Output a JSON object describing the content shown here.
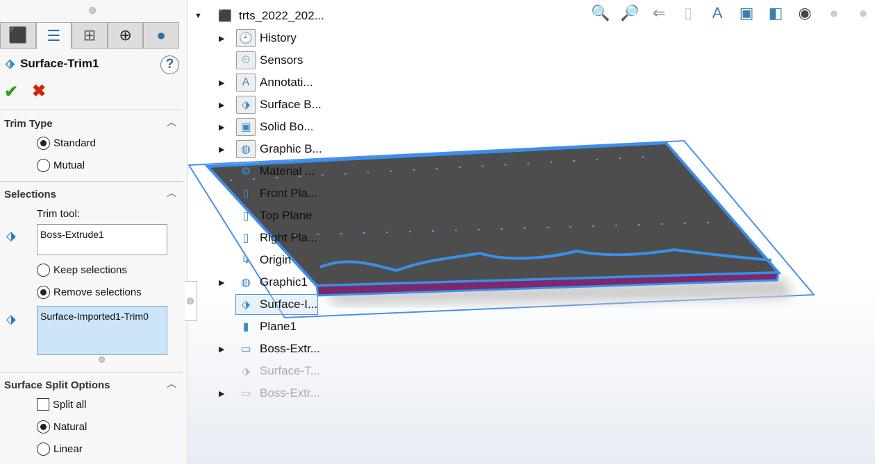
{
  "panel": {
    "tabs": [
      {
        "icon": "feature-manager-icon"
      },
      {
        "icon": "property-manager-icon"
      },
      {
        "icon": "configuration-manager-icon"
      },
      {
        "icon": "dimxpert-icon"
      },
      {
        "icon": "appearance-icon"
      }
    ],
    "title": "Surface-Trim1",
    "help": "?",
    "ok": "✔",
    "cancel": "✖",
    "trim_type": {
      "label": "Trim Type",
      "options": [
        "Standard",
        "Mutual"
      ],
      "selected": "Standard"
    },
    "selections": {
      "label": "Selections",
      "trim_tool_label": "Trim tool:",
      "trim_tool_value": "Boss-Extrude1",
      "options": [
        "Keep selections",
        "Remove selections"
      ],
      "selected": "Remove selections",
      "pieces_value": "Surface-Imported1-Trim0"
    },
    "split": {
      "label": "Surface Split Options",
      "split_all": "Split all",
      "split_all_checked": false,
      "options": [
        "Natural",
        "Linear"
      ],
      "selected": "Natural"
    }
  },
  "tree": {
    "root": "trts_2022_202...",
    "items": [
      "History",
      "Sensors",
      "Annotati...",
      "Surface B...",
      "Solid Bo...",
      "Graphic B...",
      "Material ...",
      "Front Pla...",
      "Top Plane",
      "Right Pla...",
      "Origin",
      "Graphic1",
      "Surface-I...",
      "Plane1",
      "Boss-Extr...",
      "Surface-T...",
      "Boss-Extr..."
    ]
  },
  "toolbar": [
    "zoom-to-fit-icon",
    "zoom-to-area-icon",
    "previous-view-icon",
    "section-view-icon",
    "dynamic-annotation-icon",
    "view-orientation-icon",
    "display-style-icon",
    "hide-show-icon",
    "edit-appearance-icon",
    "apply-scene-icon"
  ],
  "colors": {
    "accent": "#3c8ee8",
    "slab": "#4a4a4a"
  }
}
